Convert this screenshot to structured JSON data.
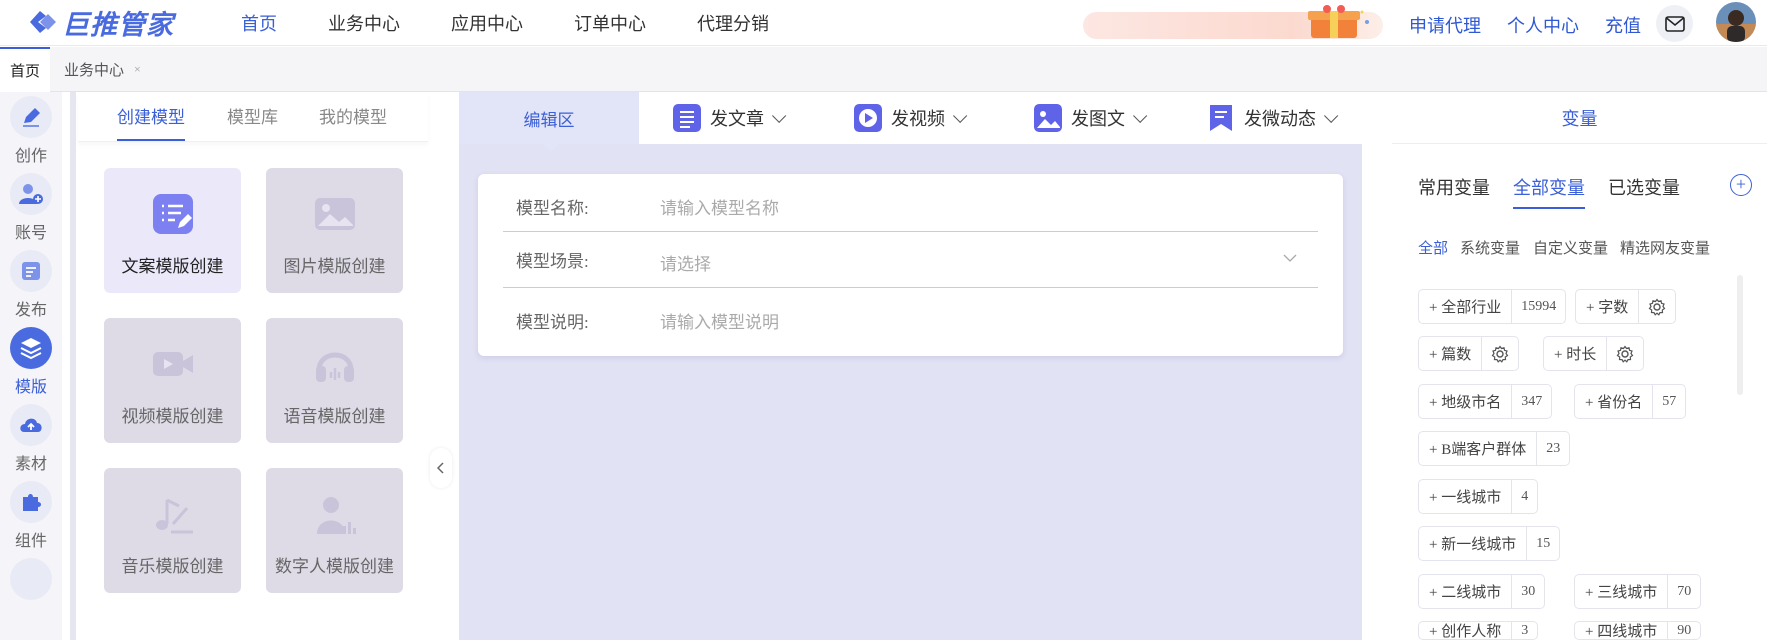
{
  "brand": {
    "name": "巨推管家"
  },
  "nav": {
    "items": [
      "首页",
      "业务中心",
      "应用中心",
      "订单中心",
      "代理分销"
    ],
    "active": 0
  },
  "toplinks": [
    "申请代理",
    "个人中心",
    "充值"
  ],
  "tabs": {
    "home": "首页",
    "business": "业务中心",
    "close": "×"
  },
  "sidebar": [
    {
      "label": "创作",
      "icon": "pen-icon"
    },
    {
      "label": "账号",
      "icon": "user-add-icon"
    },
    {
      "label": "发布",
      "icon": "publish-icon"
    },
    {
      "label": "模版",
      "icon": "layers-icon",
      "active": true
    },
    {
      "label": "素材",
      "icon": "cloud-upload-icon"
    },
    {
      "label": "组件",
      "icon": "puzzle-icon"
    }
  ],
  "model_tabs": [
    "创建模型",
    "模型库",
    "我的模型"
  ],
  "template_cards": [
    "文案模版创建",
    "图片模版创建",
    "视频模版创建",
    "语音模版创建",
    "音乐模版创建",
    "数字人模版创建"
  ],
  "editor": {
    "tab_edit": "编辑区",
    "tabs": [
      "发文章",
      "发视频",
      "发图文",
      "发微动态"
    ],
    "form": {
      "name_label": "模型名称:",
      "name_placeholder": "请输入模型名称",
      "scene_label": "模型场景:",
      "scene_placeholder": "请选择",
      "desc_label": "模型说明:",
      "desc_placeholder": "请输入模型说明"
    }
  },
  "variables": {
    "title": "变量",
    "tabs": [
      "常用变量",
      "全部变量",
      "已选变量"
    ],
    "subtabs": [
      "全部",
      "系统变量",
      "自定义变量",
      "精选网友变量"
    ],
    "chips": [
      {
        "name": "+ 全部行业",
        "count": "15994"
      },
      {
        "name": "+ 字数",
        "count": "gear"
      },
      {
        "name": "+ 篇数",
        "count": "gear"
      },
      {
        "name": "+ 时长",
        "count": "gear"
      },
      {
        "name": "+ 地级市名",
        "count": "347"
      },
      {
        "name": "+ 省份名",
        "count": "57"
      },
      {
        "name": "+ B端客户群体",
        "count": "23"
      },
      {
        "name": "+ 一线城市",
        "count": "4"
      },
      {
        "name": "+ 新一线城市",
        "count": "15"
      },
      {
        "name": "+ 二线城市",
        "count": "30"
      },
      {
        "name": "+ 三线城市",
        "count": "70"
      },
      {
        "name": "+ 创作人称",
        "count": "3"
      },
      {
        "name": "+ 四线城市",
        "count": "90"
      }
    ]
  },
  "colors": {
    "accent": "#3b5fd6",
    "editor_bg": "#e2e2f5",
    "card_bg": "#dedbe7"
  }
}
